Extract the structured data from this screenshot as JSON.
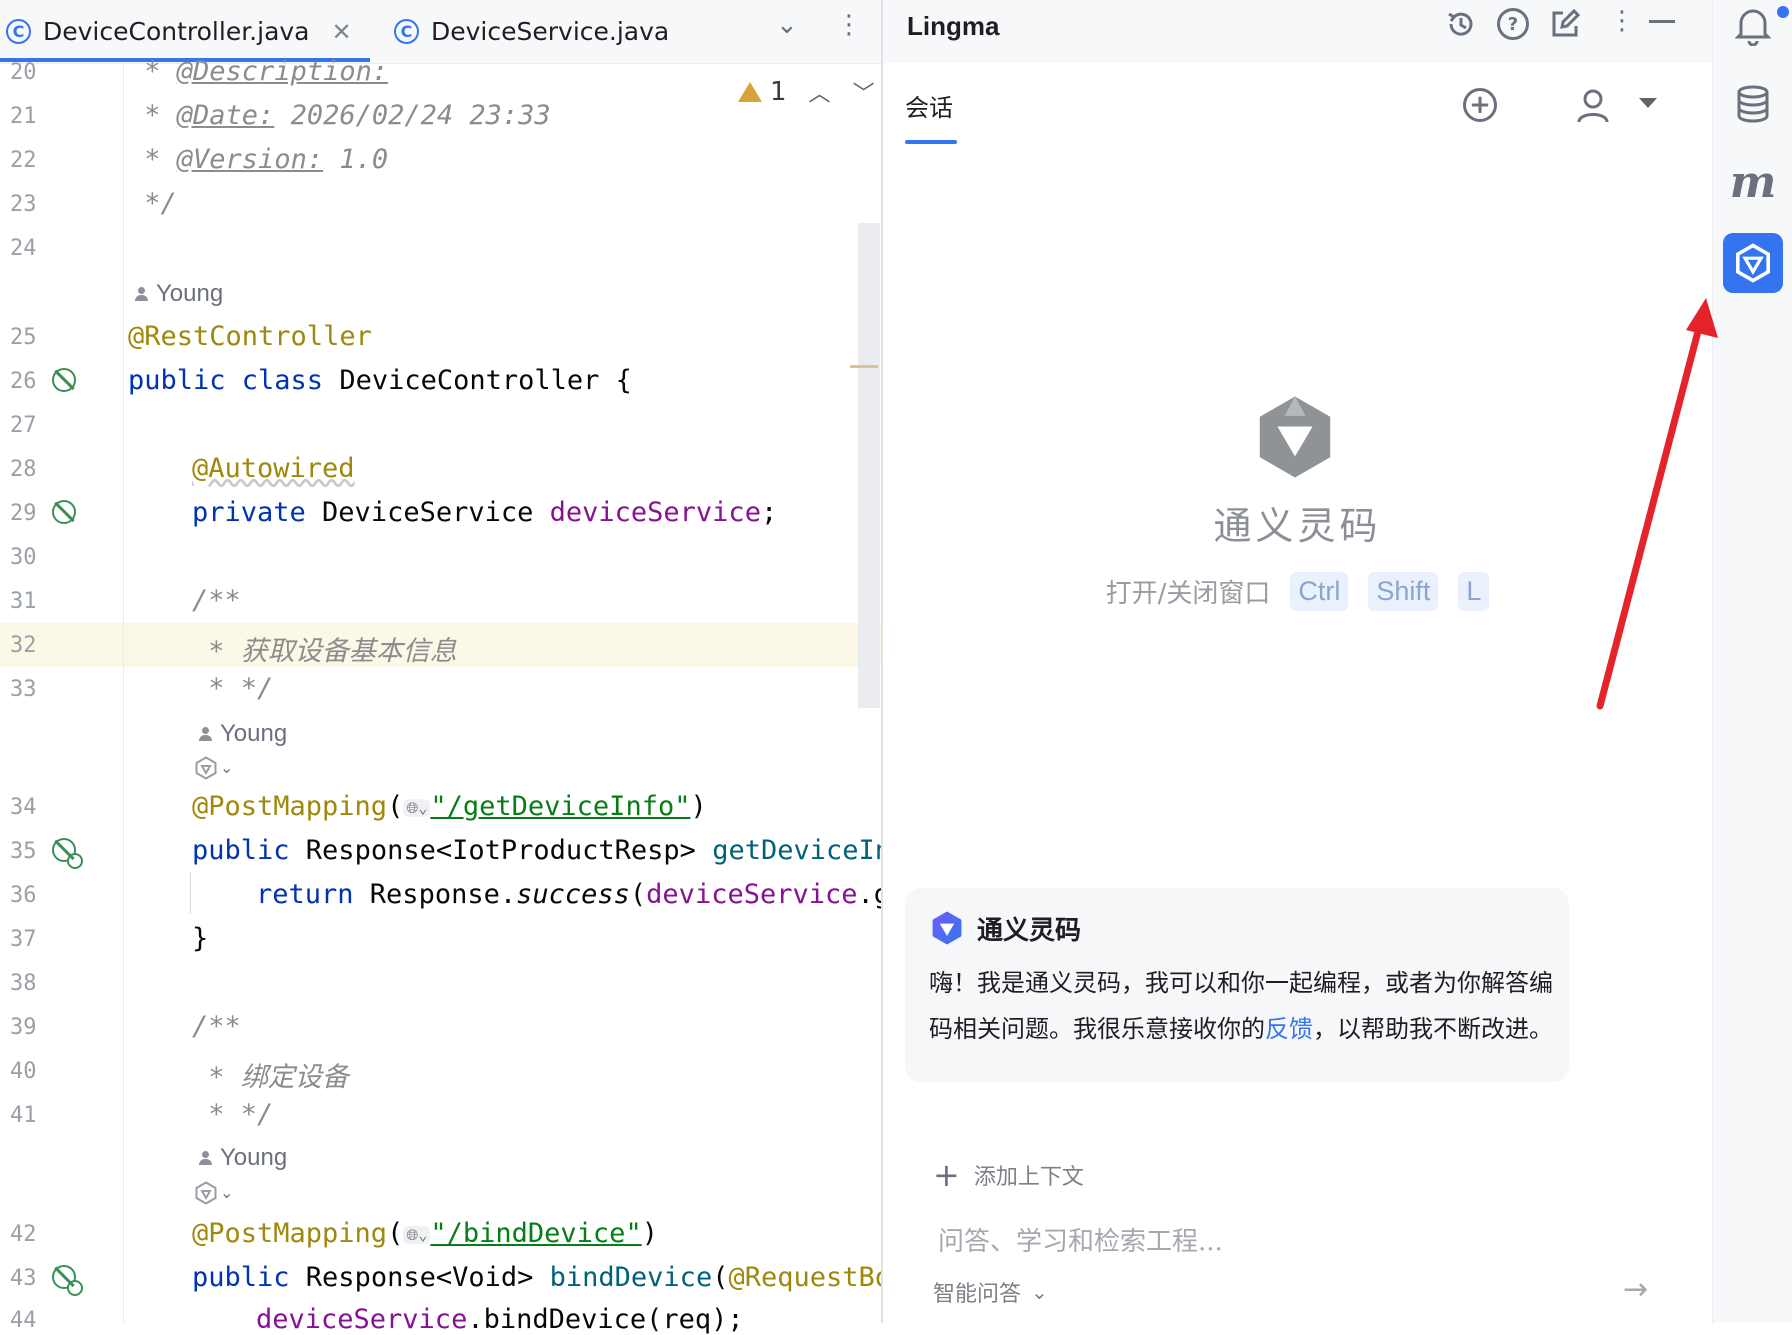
{
  "editor": {
    "tabs": [
      {
        "label": "DeviceController.java",
        "active": true
      },
      {
        "label": "DeviceService.java",
        "active": false
      }
    ],
    "inspection": {
      "warning_count": "1"
    },
    "line_numbers": [
      "20",
      "21",
      "22",
      "23",
      "24",
      "25",
      "26",
      "27",
      "28",
      "29",
      "30",
      "31",
      "32",
      "33",
      "34",
      "35",
      "36",
      "37",
      "38",
      "39",
      "40",
      "41",
      "42",
      "43",
      "44"
    ],
    "author": "Young",
    "code": {
      "l20_star": " * ",
      "l20_tag": "@Description:",
      "l21_star": " * ",
      "l21_tag": "@Date:",
      "l21_val": " 2026/02/24 23:33",
      "l22_star": " * ",
      "l22_tag": "@Version:",
      "l22_val": " 1.0",
      "l23": " */",
      "l25": "@RestController",
      "l26_kw": "public class ",
      "l26_rest": "DeviceController {",
      "l28": "@Autowired",
      "l29_kw": "private ",
      "l29_type": "DeviceService ",
      "l29_field": "deviceService",
      "l29_end": ";",
      "l31": "/**",
      "l32": " * 获取设备基本信息",
      "l33": " * */",
      "l34_ann": "@PostMapping",
      "l34_open": "(",
      "l34_str": "\"/getDeviceInfo\"",
      "l34_close": ")",
      "l35_kw": "public ",
      "l35_type": "Response<IotProductResp> ",
      "l35_mth": "getDeviceIn",
      "l36_kw": "return ",
      "l36_a": "Response.",
      "l36_b": "success",
      "l36_c": "(",
      "l36_d": "deviceService",
      "l36_e": ".g",
      "l37": "}",
      "l39": "/**",
      "l40": " * 绑定设备",
      "l41": " * */",
      "l42_ann": "@PostMapping",
      "l42_open": "(",
      "l42_str": "\"/bindDevice\"",
      "l42_close": ")",
      "l43_kw": "public ",
      "l43_type": "Response<Void> ",
      "l43_mth": "bindDevice",
      "l43_open": "(",
      "l43_ann": "@RequestBo",
      "l44_field": "deviceService",
      "l44_rest": ".bindDevice(req);"
    }
  },
  "panel": {
    "title": "Lingma",
    "tab_label": "会话",
    "brand_title": "通义灵码",
    "shortcut_label": "打开/关闭窗口",
    "shortcut_keys": [
      "Ctrl",
      "Shift",
      "L"
    ],
    "welcome": {
      "title": "通义灵码",
      "text_before": "嗨！我是通义灵码，我可以和你一起编程，或者为你解答编码相关问题。我很乐意接收你的",
      "link": "反馈",
      "text_after": "，以帮助我不断改进。"
    },
    "add_context": "添加上下文",
    "input_placeholder": "问答、学习和检索工程...",
    "mode": "智能问答"
  },
  "colors": {
    "accent": "#3574f0",
    "annotation_arrow": "#e5232b"
  }
}
